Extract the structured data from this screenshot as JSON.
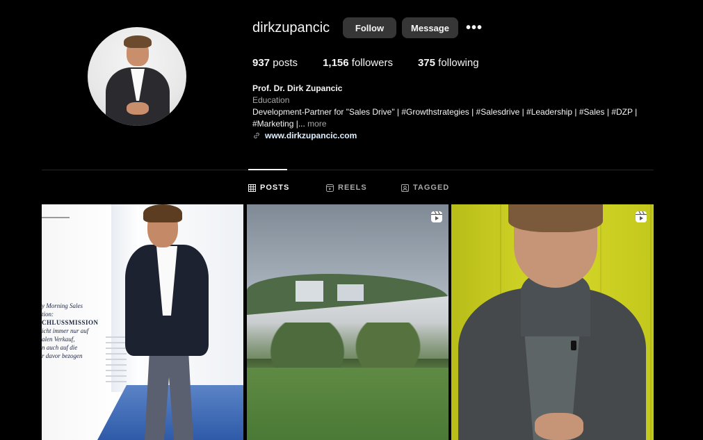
{
  "profile": {
    "username": "dirkzupancic",
    "follow_label": "Follow",
    "message_label": "Message",
    "more_label": "•••",
    "stats": {
      "posts_count": "937",
      "posts_label": "posts",
      "followers_count": "1,156",
      "followers_label": "followers",
      "following_count": "375",
      "following_label": "following"
    },
    "full_name": "Prof. Dr. Dirk Zupancic",
    "category": "Education",
    "bio": "Development-Partner for \"Sales Drive\" | #Growthstrategies | #Salesdrive | #Leadership | #Sales | #DZP | #Marketing |...",
    "bio_more": "more",
    "link": "www.dirkzupancic.com"
  },
  "tabs": [
    {
      "label": "POSTS",
      "icon": "grid-icon",
      "active": true
    },
    {
      "label": "REELS",
      "icon": "reels-icon",
      "active": false
    },
    {
      "label": "TAGGED",
      "icon": "tagged-icon",
      "active": false
    }
  ],
  "posts": [
    {
      "type": "image",
      "overlay_text": [
        "y Morning Sales",
        "tion:",
        "CHLUSSMISSION",
        "icht immer nur auf",
        "alen Verkauf,",
        "n auch auf die",
        "r davor bezogen"
      ]
    },
    {
      "type": "reel",
      "icon": "reel-icon"
    },
    {
      "type": "reel",
      "icon": "reel-icon"
    }
  ],
  "colors": {
    "background": "#000000",
    "button": "#363636",
    "text": "#f5f5f5",
    "muted": "#a8a8a8",
    "divider": "#262626",
    "link": "#e0f1ff"
  }
}
